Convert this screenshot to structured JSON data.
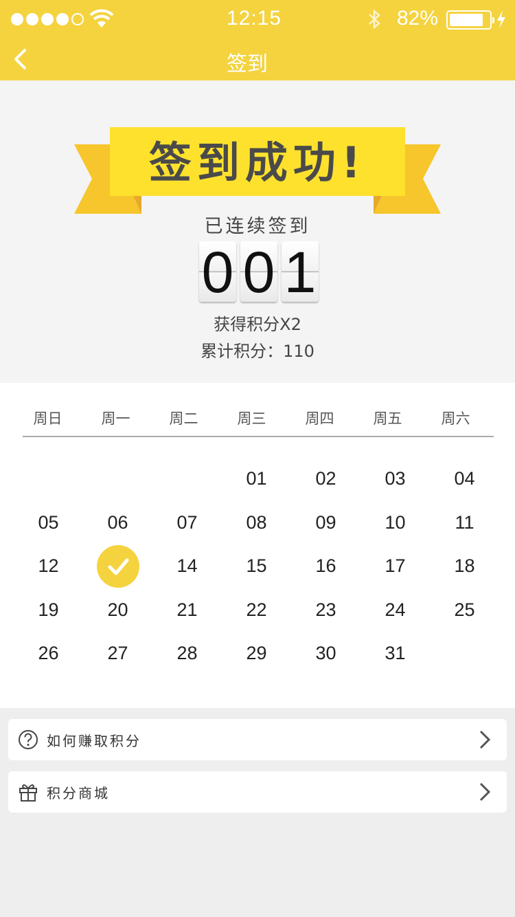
{
  "status_bar": {
    "time": "12:15",
    "battery": "82%",
    "battery_level": 0.82,
    "signal_bars": 4
  },
  "nav": {
    "title": "签到"
  },
  "success": {
    "banner": "签到成功!",
    "streak_label": "已连续签到",
    "streak_digits": [
      "0",
      "0",
      "1"
    ],
    "bonus": "获得积分X2",
    "total_points": "累计积分：110"
  },
  "calendar": {
    "weekdays": [
      "周日",
      "周一",
      "周二",
      "周三",
      "周四",
      "周五",
      "周六"
    ],
    "leading_blanks": 3,
    "days": [
      "01",
      "02",
      "03",
      "04",
      "05",
      "06",
      "07",
      "08",
      "09",
      "10",
      "11",
      "12",
      "13",
      "14",
      "15",
      "16",
      "17",
      "18",
      "19",
      "20",
      "21",
      "22",
      "23",
      "24",
      "25",
      "26",
      "27",
      "28",
      "29",
      "30",
      "31"
    ],
    "checked_day": "13"
  },
  "menu": {
    "earn_points": "如何赚取积分",
    "points_mall": "积分商城"
  },
  "colors": {
    "accent": "#f4d33f",
    "banner": "#fde12d",
    "ribbon_side": "#f7c52c"
  }
}
